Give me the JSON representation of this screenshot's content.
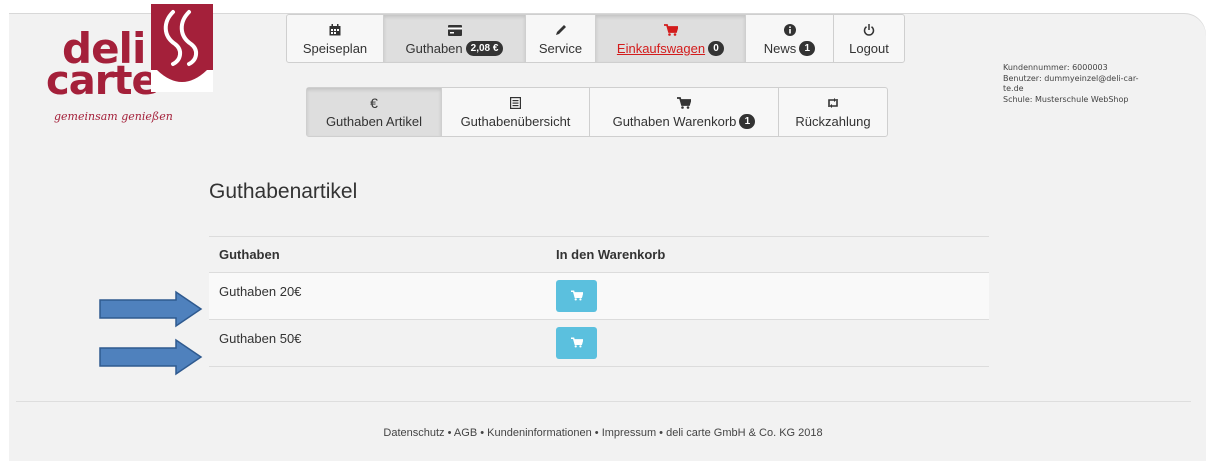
{
  "colors": {
    "brand": "#a4203a",
    "accent_button": "#5bc0de",
    "cart_red": "#d31c1c",
    "arrow_blue": "#4f81bd"
  },
  "logo": {
    "line1": "deli",
    "line2": "carte",
    "tagline": "gemeinsam genießen"
  },
  "main_nav": [
    {
      "label": "Speiseplan",
      "icon": "calendar-icon"
    },
    {
      "label": "Guthaben",
      "badge": "2,08 €",
      "icon": "credit-card-icon",
      "active": true
    },
    {
      "label": "Service",
      "icon": "pencil-icon"
    },
    {
      "label": "Einkaufswagen",
      "badge": "0",
      "icon": "cart-icon",
      "active": true
    },
    {
      "label": "News",
      "badge": "1",
      "icon": "info-icon"
    },
    {
      "label": "Logout",
      "icon": "power-icon"
    }
  ],
  "sub_nav": [
    {
      "label": "Guthaben Artikel",
      "icon": "euro-icon",
      "icon_glyph": "€",
      "active": true
    },
    {
      "label": "Guthabenübersicht",
      "icon": "list-icon"
    },
    {
      "label": "Guthaben Warenkorb",
      "badge": "1",
      "icon": "cart-icon"
    },
    {
      "label": "Rückzahlung",
      "icon": "retweet-icon"
    }
  ],
  "account": {
    "customer_number": "Kundennummer: 6000003",
    "user_line1": "Benutzer: dummyeinzel@deli-car-",
    "user_line2": "te.de",
    "school": "Schule: Musterschule WebShop"
  },
  "page_title": "Guthabenartikel",
  "table": {
    "headers": [
      "Guthaben",
      "In den Warenkorb"
    ],
    "rows": [
      {
        "name": "Guthaben 20€"
      },
      {
        "name": "Guthaben 50€"
      }
    ]
  },
  "footer": {
    "links": [
      "Datenschutz",
      "AGB",
      "Kundeninformationen",
      "Impressum"
    ],
    "copyright": "deli carte GmbH & Co. KG 2018",
    "separator": "•"
  }
}
